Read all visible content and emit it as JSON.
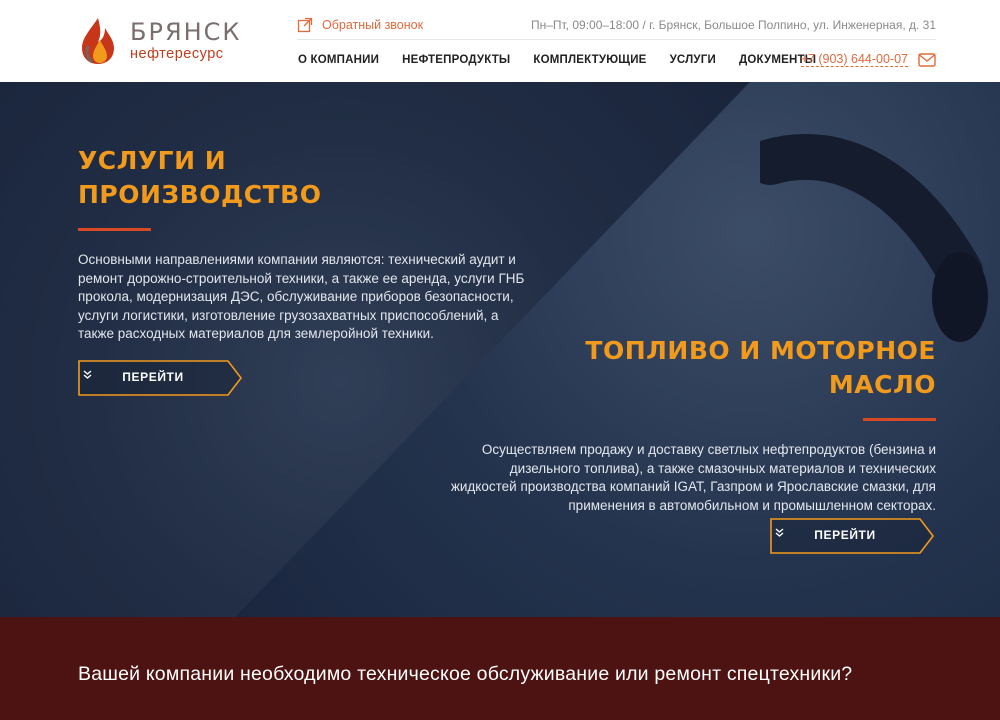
{
  "header": {
    "logo": {
      "name": "БРЯНСК",
      "subtitle": "нефтересурс"
    },
    "callback_label": "Обратный звонок",
    "hours_address": "Пн–Пт, 09:00–18:00 / г. Брянск, Большое Полпино, ул. Инженерная, д. 31",
    "nav": [
      {
        "label": "О КОМПАНИИ"
      },
      {
        "label": "НЕФТЕПРОДУКТЫ"
      },
      {
        "label": "КОМПЛЕКТУЮЩИЕ"
      },
      {
        "label": "УСЛУГИ"
      },
      {
        "label": "ДОКУМЕНТЫ"
      }
    ],
    "phone": "+7 (903) 644-00-07"
  },
  "hero": {
    "services": {
      "title_line1": "УСЛУГИ И",
      "title_line2": "ПРОИЗВОДСТВО",
      "description": "Основными направлениями компании являются: технический аудит и ремонт дорожно-строительной техники, а также ее аренда, услуги ГНБ прокола, модернизация ДЭС, обслуживание приборов безопасности, услуги логистики, изготовление грузозахватных приспособлений, а также расходных материалов для землеройной техники.",
      "button_label": "ПЕРЕЙТИ"
    },
    "fuel": {
      "title_line1": "ТОПЛИВО И МОТОРНОЕ",
      "title_line2": "МАСЛО",
      "description": "Осуществляем продажу и доставку светлых нефтепродуктов (бензина и дизельного топлива), а также смазочных материалов и технических жидкостей производства компаний IGAT, Газпром и Ярославские смазки, для применения в автомобильном и промышленном секторах.",
      "button_label": "ПЕРЕЙТИ"
    }
  },
  "banner": {
    "text": "Вашей компании необходимо техническое обслуживание или ремонт спецтехники?"
  },
  "colors": {
    "accent_orange": "#f29a1c",
    "accent_red": "#d84a24",
    "link_orange": "#e06a3c",
    "banner_bg": "#4d1212",
    "hero_bg": "#1f2c45"
  },
  "icons": [
    "flame-drop-logo-icon",
    "external-link-icon",
    "mail-icon",
    "chevron-double-down-icon"
  ]
}
